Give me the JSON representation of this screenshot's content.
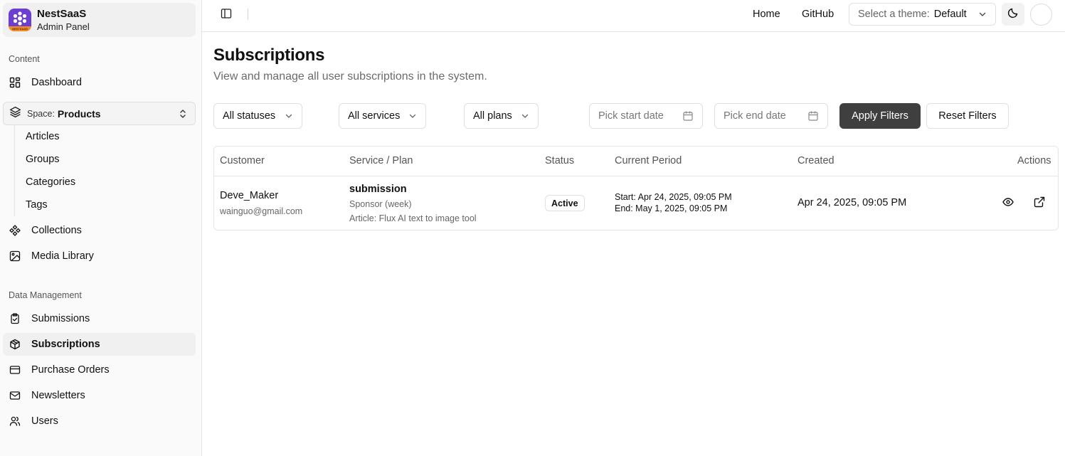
{
  "brand": {
    "name": "NestSaaS",
    "subtitle": "Admin Panel",
    "logo_band_text": "NESTSAAS"
  },
  "sidebar": {
    "content_label": "Content",
    "dashboard": "Dashboard",
    "space": {
      "label": "Space:",
      "value": "Products"
    },
    "space_items": [
      "Articles",
      "Groups",
      "Categories",
      "Tags"
    ],
    "collections": "Collections",
    "media_library": "Media Library",
    "data_label": "Data Management",
    "data_items": [
      "Submissions",
      "Subscriptions",
      "Purchase Orders",
      "Newsletters",
      "Users"
    ],
    "active_item": "Subscriptions"
  },
  "topbar": {
    "home": "Home",
    "github": "GitHub",
    "theme_label": "Select a theme:",
    "theme_value": "Default"
  },
  "page": {
    "title": "Subscriptions",
    "description": "View and manage all user subscriptions in the system."
  },
  "filters": {
    "status": "All statuses",
    "services": "All services",
    "plans": "All plans",
    "start_date_placeholder": "Pick start date",
    "end_date_placeholder": "Pick end date",
    "apply": "Apply Filters",
    "reset": "Reset Filters"
  },
  "table": {
    "columns": [
      "Customer",
      "Service / Plan",
      "Status",
      "Current Period",
      "Created",
      "Actions"
    ],
    "rows": [
      {
        "customer_name": "Deve_Maker",
        "customer_email": "wainguo@gmail.com",
        "service": "submission",
        "plan": "Sponsor (week)",
        "article": "Article: Flux AI text to image tool",
        "status": "Active",
        "period_start": "Start: Apr 24, 2025, 09:05 PM",
        "period_end": "End: May 1, 2025, 09:05 PM",
        "created": "Apr 24, 2025, 09:05 PM"
      }
    ]
  },
  "colors": {
    "primary_button": "#3f3f3f",
    "logo": "#6d3fd0",
    "logo_band": "#f28c28"
  }
}
